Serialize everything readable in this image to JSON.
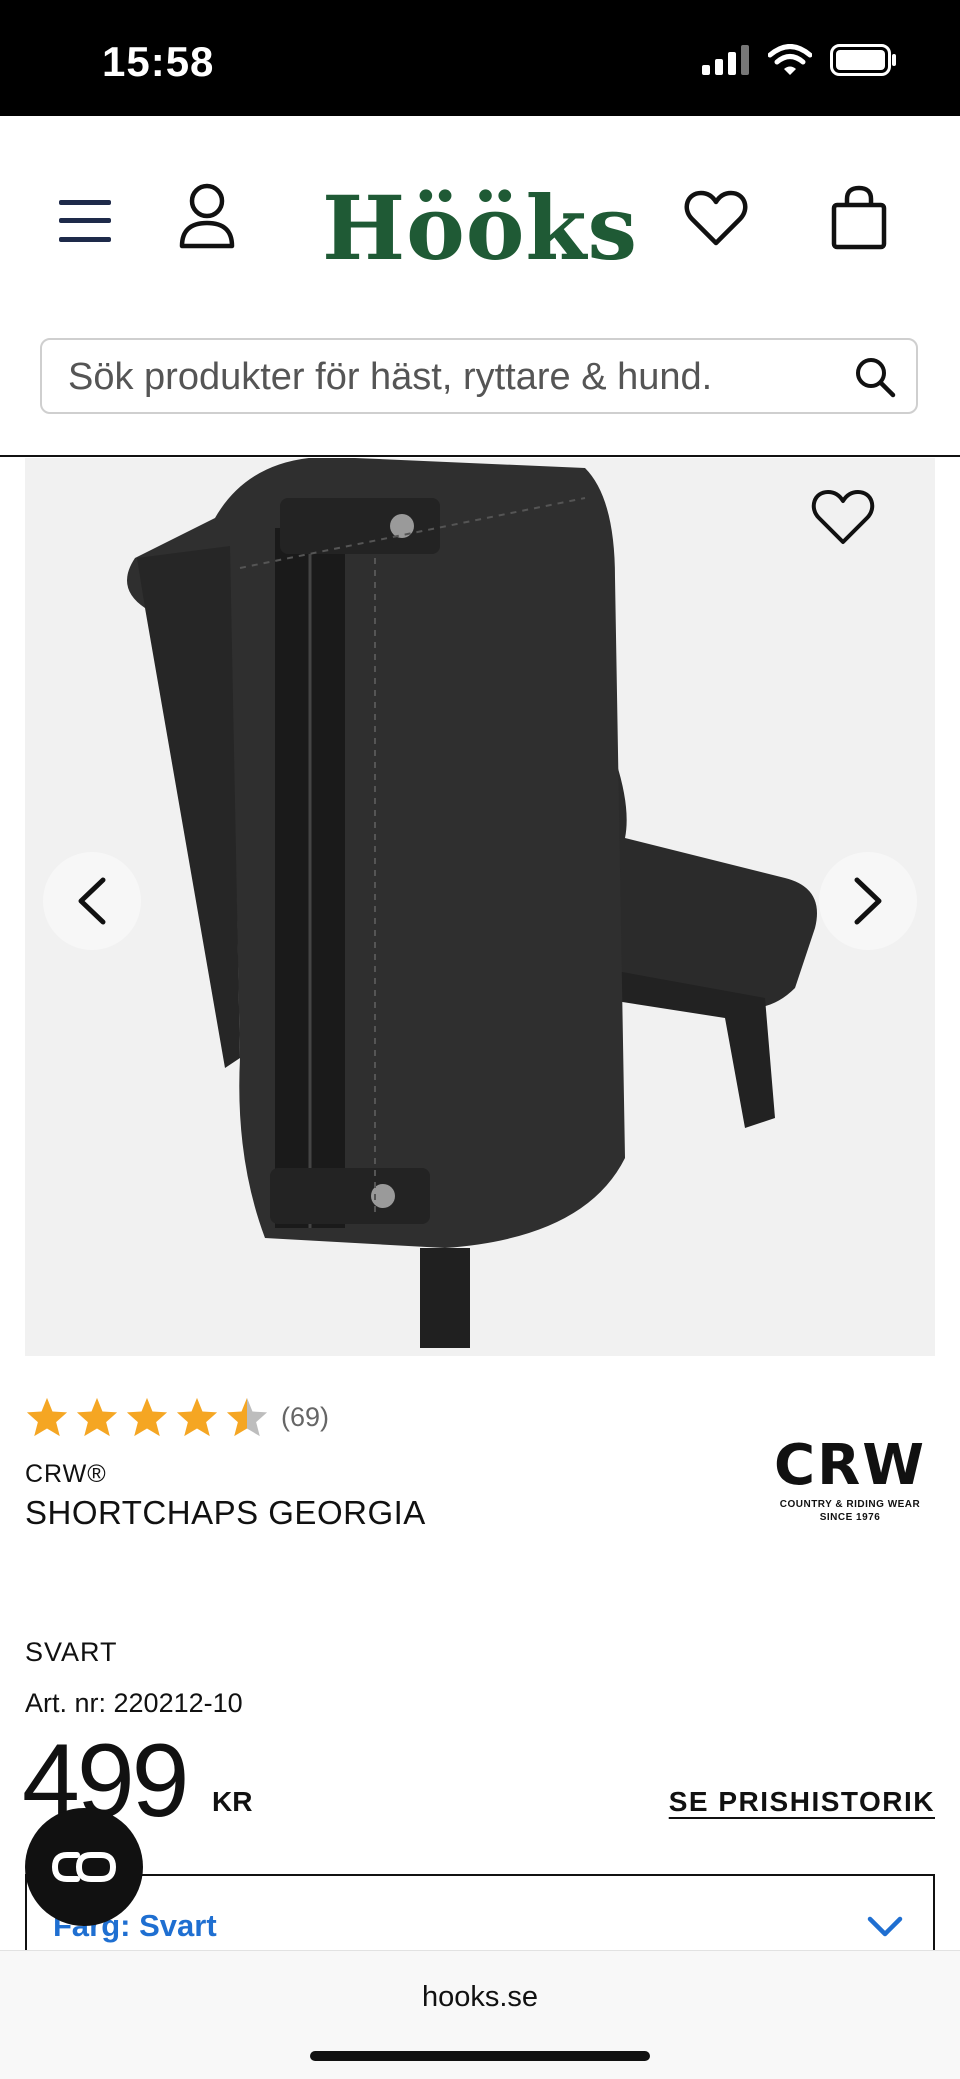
{
  "status_bar": {
    "time": "15:58"
  },
  "header": {
    "brand": "Hööks",
    "search_placeholder": "Sök produkter för häst, ryttare & hund."
  },
  "product": {
    "rating_value": 4.5,
    "rating_count": "(69)",
    "brand": "CRW®",
    "title": "SHORTCHAPS GEORGIA",
    "brand_logo_main": "CRW",
    "brand_logo_sub_line1": "COUNTRY & RIDING WEAR",
    "brand_logo_sub_line2": "SINCE 1976",
    "color": "SVART",
    "article_number": "Art. nr: 220212-10",
    "price": "499",
    "currency": "KR",
    "price_history_link": "SE PRISHISTORIK",
    "variant_label": "Färg: Svart"
  },
  "browser": {
    "url": "hooks.se"
  },
  "colors": {
    "brand_green": "#1f5a35",
    "star_gold": "#f5a623",
    "link_blue": "#1f6fd1"
  }
}
